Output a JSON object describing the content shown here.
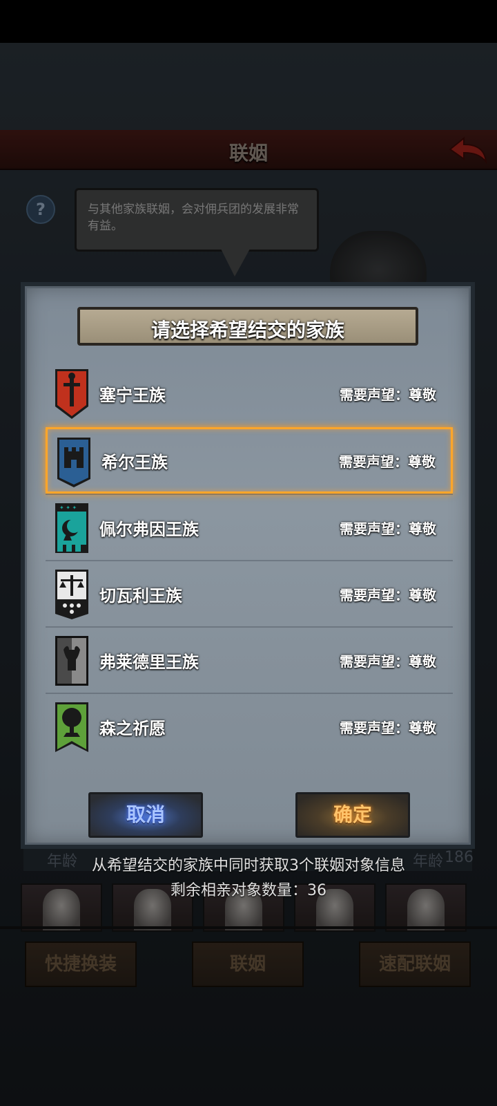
{
  "header": {
    "title": "联姻"
  },
  "help": {
    "label": "?"
  },
  "npc": {
    "speech": "与其他家族联姻，会对佣兵团的发展非常有益。"
  },
  "background": {
    "age_label": "年龄",
    "age_value_right": "186",
    "footer_buttons": [
      "快捷换装",
      "联姻",
      "速配联姻"
    ]
  },
  "modal": {
    "title": "请选择希望结交的家族",
    "families": [
      {
        "name": "塞宁王族",
        "requirement": "需要声望：尊敬",
        "crest": "red-sword-crest-icon",
        "color": "#c0311d"
      },
      {
        "name": "希尔王族",
        "requirement": "需要声望：尊敬",
        "crest": "blue-fortress-crest-icon",
        "color": "#2b5f94",
        "selected": true
      },
      {
        "name": "佩尔弗因王族",
        "requirement": "需要声望：尊敬",
        "crest": "teal-moon-crest-icon",
        "color": "#1aa39b"
      },
      {
        "name": "切瓦利王族",
        "requirement": "需要声望：尊敬",
        "crest": "white-scales-crest-icon",
        "color": "#e8e8e8"
      },
      {
        "name": "弗莱德里王族",
        "requirement": "需要声望：尊敬",
        "crest": "black-bull-crest-icon",
        "color": "#3a3a3a"
      },
      {
        "name": "森之祈愿",
        "requirement": "需要声望：尊敬",
        "crest": "green-tree-crest-icon",
        "color": "#5ea13a"
      }
    ],
    "cancel_label": "取消",
    "confirm_label": "确定"
  },
  "info": {
    "line1": "从希望结交的家族中同时获取3个联姻对象信息",
    "line2": "剩余相亲对象数量：36"
  }
}
